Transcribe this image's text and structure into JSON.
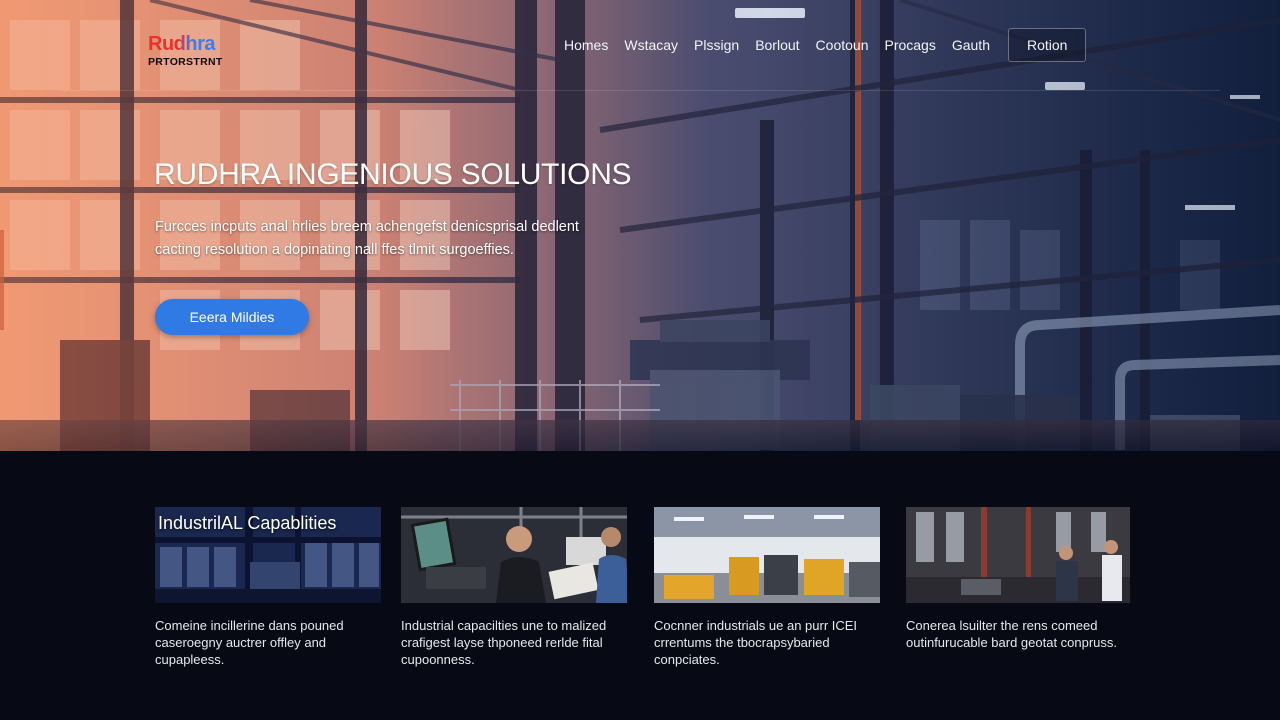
{
  "logo": {
    "name": "Rudhra",
    "tagline": "PRTORSTRNT"
  },
  "nav": {
    "items": [
      "Homes",
      "Wstacay",
      "Plssign",
      "Borlout",
      "Cootoun",
      "Procags",
      "Gauth"
    ],
    "cta": "Rotion"
  },
  "hero": {
    "title": "RUDHRA INGENIOUS SOLUTIONS",
    "description": "Furcces incputs anal hrlies breem achengefst denicsprisal dedlent cacting resolution a dopinating nall ffes tlmit surgoeffies.",
    "button": "Eeera Mildies"
  },
  "cards": [
    {
      "heading": "IndustrilAL Capablities",
      "text": "Comeine incillerine dans pouned caseroegny auctrer offley and cupapleess."
    },
    {
      "heading": "",
      "text": "Industrial capacilties une to malized crafigest layse thponeed rerlde fital cupoonness."
    },
    {
      "heading": "",
      "text": "Cocnner industrials ue an purr ICEI crrentums the tbocrapsybaried conpciates."
    },
    {
      "heading": "",
      "text": "Conerea lsuilter the rens comeed outinfurucable bard geotat conpruss."
    }
  ],
  "colors": {
    "primary_button": "#2f7ae5",
    "logo_red": "#e8322a",
    "logo_blue": "#3b7df0",
    "background": "#070a14"
  }
}
